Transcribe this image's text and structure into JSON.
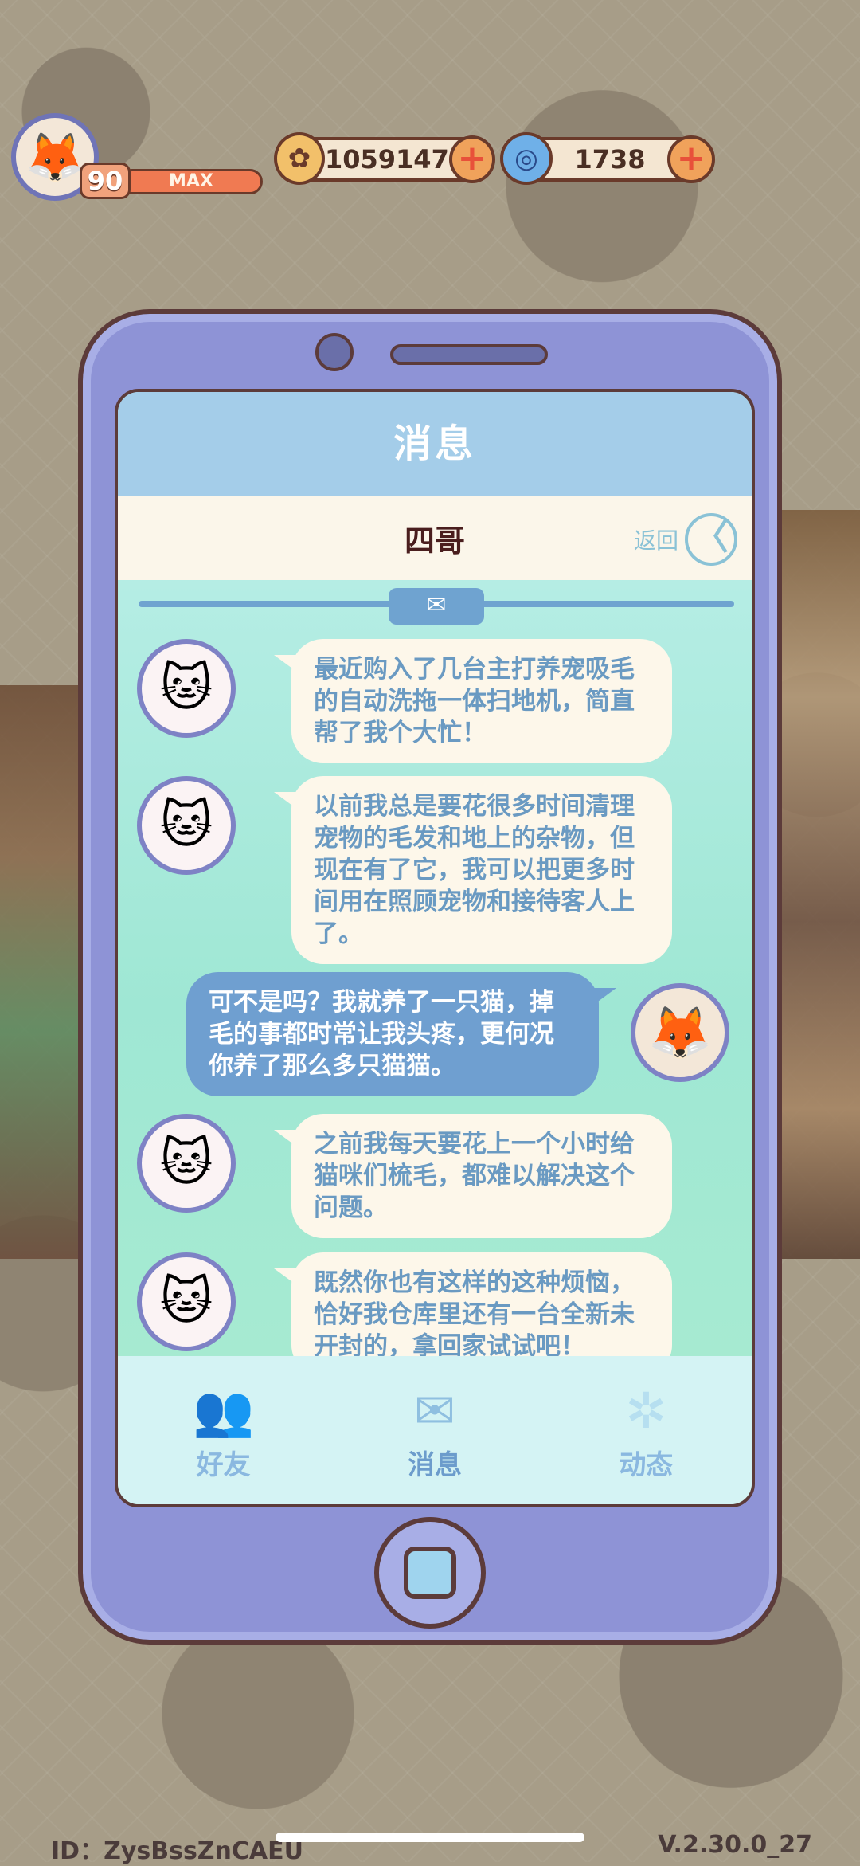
{
  "top_bar": {
    "level": "90",
    "level_status": "MAX",
    "coins": "1059147",
    "gems": "1738",
    "plus_symbol": "+"
  },
  "phone": {
    "header_title": "消息",
    "contact_name": "四哥",
    "back_label": "返回",
    "back_symbol": "〈",
    "messages": [
      {
        "side": "left",
        "text": "最近购入了几台主打养宠吸毛的自动洗拖一体扫地机，简直帮了我个大忙！"
      },
      {
        "side": "left",
        "text": "以前我总是要花很多时间清理宠物的毛发和地上的杂物，但现在有了它，我可以把更多时间用在照顾宠物和接待客人上了。"
      },
      {
        "side": "right",
        "text": "可不是吗？我就养了一只猫，掉毛的事都时常让我头疼，更何况你养了那么多只猫猫。"
      },
      {
        "side": "left",
        "text": "之前我每天要花上一个小时给猫咪们梳毛，都难以解决这个问题。"
      },
      {
        "side": "left",
        "text": "既然你也有这样的这种烦恼，恰好我仓库里还有一台全新未开封的，拿回家试试吧！"
      }
    ],
    "nav": [
      {
        "label": "好友",
        "icon": "friends-icon"
      },
      {
        "label": "消息",
        "icon": "mail-icon"
      },
      {
        "label": "动态",
        "icon": "moments-icon"
      }
    ]
  },
  "footer": {
    "id_text": "ID：ZysBssZnCAEU",
    "version": "V.2.30.0_27"
  }
}
